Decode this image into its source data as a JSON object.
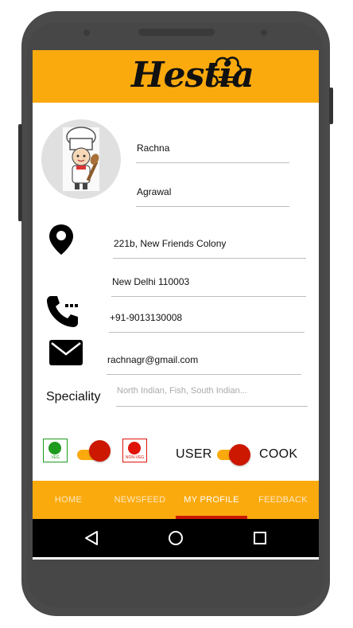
{
  "app": {
    "logo_text": "Hestia"
  },
  "profile": {
    "first_name": "Rachna",
    "last_name": "Agrawal",
    "address_line1": "221b, New Friends Colony",
    "address_line2": "New Delhi 110003",
    "phone": "+91-9013130008",
    "email": "rachnagr@gmail.com",
    "speciality_label": "Speciality",
    "speciality_placeholder": "North Indian, Fish, South Indian..."
  },
  "diet": {
    "veg_label": "VEG",
    "nonveg_label": "NON-VEG"
  },
  "role": {
    "user_label": "USER",
    "cook_label": "COOK"
  },
  "nav": {
    "items": [
      {
        "label": "HOME"
      },
      {
        "label": "NEWSFEED"
      },
      {
        "label": "MY PROFILE"
      },
      {
        "label": "FEEDBACK"
      }
    ],
    "active": "MY PROFILE"
  },
  "colors": {
    "accent": "#fbaa0e",
    "toggle_knob": "#cc1800",
    "veg": "#1e9b1e",
    "nonveg": "#e0130b"
  },
  "icons": [
    "chef-hat-icon",
    "location-pin-icon",
    "phone-icon",
    "mail-icon",
    "back-icon",
    "home-icon",
    "recents-icon"
  ]
}
